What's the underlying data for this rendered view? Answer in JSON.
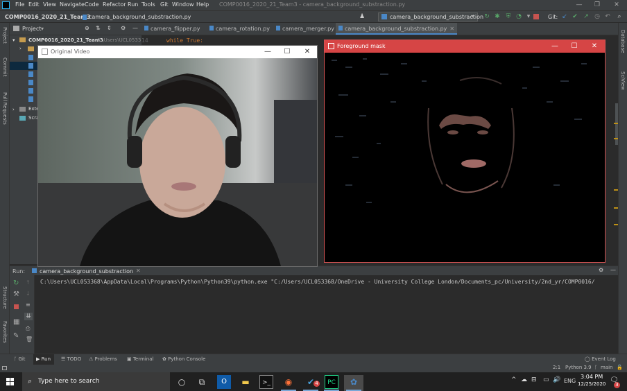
{
  "menubar": {
    "items": [
      "File",
      "Edit",
      "View",
      "Navigate",
      "Code",
      "Refactor",
      "Run",
      "Tools",
      "Git",
      "Window",
      "Help"
    ],
    "window_title": "COMP0016_2020_21_Team3 - camera_background_substraction.py",
    "buttons": {
      "minimize": "—",
      "maximize": "❐",
      "close": "✕"
    }
  },
  "navbar": {
    "project": "COMP0016_2020_21_Team3",
    "file": "camera_background_substraction.py",
    "run_config": "camera_background_substraction",
    "git_label": "Git:"
  },
  "project_panel": {
    "title": "Project",
    "root": "COMP0016_2020_21_Team3",
    "root_path": "C:\\Users\\UCL0533",
    "ext_libs": "Exte",
    "scratches": "Scra"
  },
  "editor": {
    "tabs": [
      "camera_flipper.py",
      "camera_rotation.py",
      "camera_merger.py",
      "camera_background_substraction.py"
    ],
    "line_number": "14",
    "code_line": "while True:"
  },
  "left_strip": {
    "labels": [
      "Project",
      "Commit",
      "Pull Requests",
      "Structure",
      "Favorites"
    ]
  },
  "right_strip": {
    "labels": [
      "Database",
      "SciView"
    ]
  },
  "run_panel": {
    "label": "Run:",
    "tab": "camera_background_substraction",
    "console_line": "C:\\Users\\UCL053368\\AppData\\Local\\Programs\\Python\\Python39\\python.exe \"C:/Users/UCL053368/OneDrive - University College London/Documents_pc/University/2nd_yr/COMP0016/"
  },
  "bottom_tabs": [
    "Git",
    "Run",
    "TODO",
    "Problems",
    "Terminal",
    "Python Console"
  ],
  "event_log": "Event Log",
  "status": {
    "position": "2:1",
    "interpreter": "Python 3.9",
    "branch": "main"
  },
  "window_original": {
    "title": "Original Video"
  },
  "window_mask": {
    "title": "Foreground mask"
  },
  "taskbar": {
    "search_placeholder": "Type here to search",
    "language": "ENG",
    "time": "3:04 PM",
    "date": "12/25/2020",
    "notifications": "3",
    "badge": "4"
  }
}
